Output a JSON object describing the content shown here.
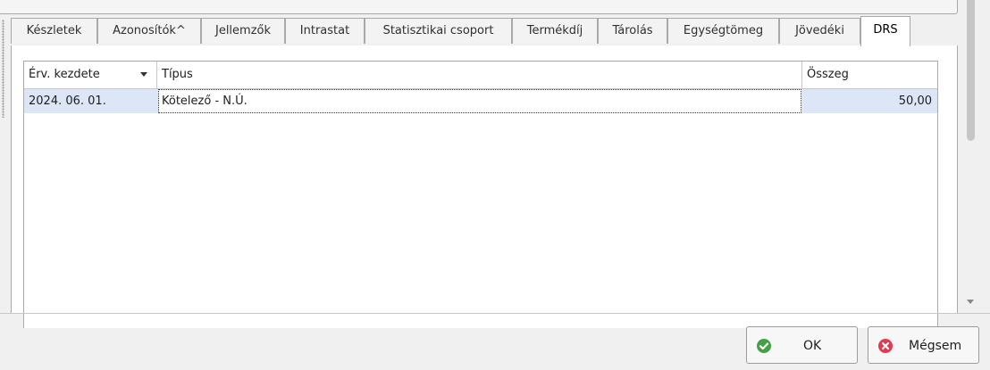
{
  "tabs": [
    {
      "label": "Készletek"
    },
    {
      "label": "Azonosítók^"
    },
    {
      "label": "Jellemzők"
    },
    {
      "label": "Intrastat"
    },
    {
      "label": "Statisztikai csoport"
    },
    {
      "label": "Termékdíj"
    },
    {
      "label": "Tárolás"
    },
    {
      "label": "Egységtömeg"
    },
    {
      "label": "Jövedéki"
    },
    {
      "label": "DRS"
    }
  ],
  "active_tab": "DRS",
  "grid": {
    "columns": [
      {
        "label": "Érv. kezdete",
        "sorted": "descending"
      },
      {
        "label": "Típus"
      },
      {
        "label": "Összeg"
      }
    ],
    "rows": [
      {
        "date": "2024. 06. 01.",
        "type": "Kötelező - N.Ú.",
        "amount": "50,00"
      }
    ]
  },
  "buttons": {
    "ok_label": "OK",
    "cancel_label": "Mégsem"
  },
  "colors": {
    "selected_row": "#dde6f7",
    "ok_icon": "#43a047",
    "cancel_icon": "#e53950"
  },
  "icons": {
    "ok": "check-circle-icon",
    "cancel": "x-circle-icon"
  }
}
